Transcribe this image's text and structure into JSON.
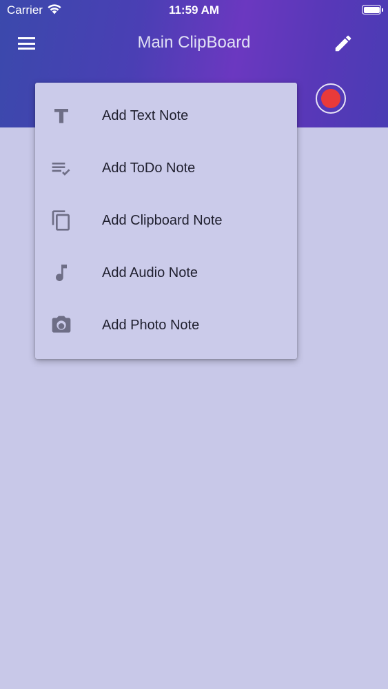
{
  "status_bar": {
    "carrier": "Carrier",
    "time": "11:59 AM"
  },
  "app_bar": {
    "title": "Main ClipBoard"
  },
  "menu": {
    "items": [
      {
        "label": "Add Text Note",
        "icon": "text-icon"
      },
      {
        "label": "Add ToDo Note",
        "icon": "checklist-icon"
      },
      {
        "label": "Add Clipboard Note",
        "icon": "copy-icon"
      },
      {
        "label": "Add Audio Note",
        "icon": "music-note-icon"
      },
      {
        "label": "Add Photo Note",
        "icon": "camera-icon"
      }
    ]
  },
  "colors": {
    "header_gradient_start": "#3b49ac",
    "header_gradient_mid": "#6b38c0",
    "background": "#c8c8e8",
    "menu_background": "#cbcbea",
    "record_red": "#e93a3a",
    "icon_gray": "#6e6e86"
  }
}
